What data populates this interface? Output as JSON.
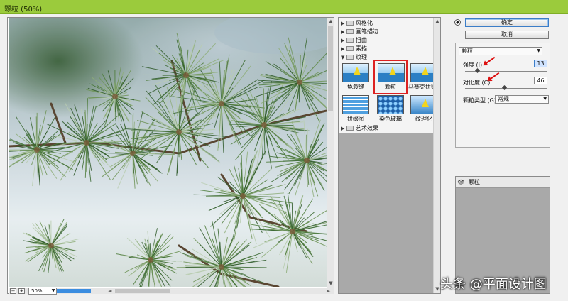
{
  "window": {
    "title": "颗粒 (50%)"
  },
  "preview": {
    "zoom": "50%",
    "zoom_out": "−",
    "zoom_in": "+"
  },
  "gallery": {
    "categories": [
      {
        "label": "风格化",
        "expanded": false
      },
      {
        "label": "画笔描边",
        "expanded": false
      },
      {
        "label": "扭曲",
        "expanded": false
      },
      {
        "label": "素描",
        "expanded": false
      },
      {
        "label": "纹理",
        "expanded": true
      }
    ],
    "thumbnails": [
      {
        "label": "龟裂缝",
        "selected": false
      },
      {
        "label": "颗粒",
        "selected": true
      },
      {
        "label": "马赛克拼贴",
        "selected": false
      },
      {
        "label": "拼缀图",
        "selected": false
      },
      {
        "label": "染色玻璃",
        "selected": false
      },
      {
        "label": "纹理化",
        "selected": false
      }
    ],
    "after": [
      {
        "label": "艺术效果",
        "expanded": false
      }
    ]
  },
  "buttons": {
    "ok": "确定",
    "cancel": "取消"
  },
  "params": {
    "filter": "颗粒",
    "intensity": {
      "label": "强度 (I)",
      "value": "13",
      "fraction": 0.13
    },
    "contrast": {
      "label": "对比度 (C)",
      "value": "46",
      "fraction": 0.46
    },
    "grain_type": {
      "label": "颗粒类型 (G):",
      "value": "常规"
    }
  },
  "layers": [
    {
      "name": "颗粒",
      "visible": true
    }
  ],
  "watermark": "头条 @平面设计图"
}
